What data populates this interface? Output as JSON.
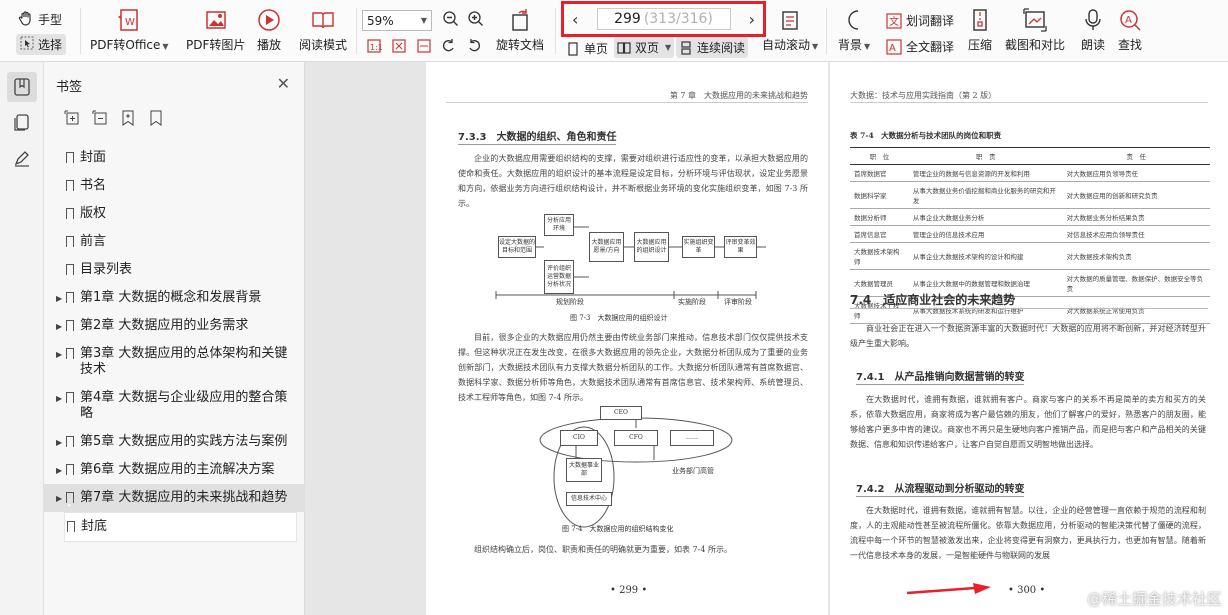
{
  "toolbar": {
    "hand_tool": "手型",
    "select_tool": "选择",
    "pdf_to_office": "PDF转Office",
    "pdf_to_image": "PDF转图片",
    "play": "播放",
    "reading_mode": "阅读模式",
    "zoom_value": "59%",
    "rotate_doc": "旋转文档",
    "current_page": "299",
    "total_pages": "(313/316)",
    "single_page": "单页",
    "double_page": "双页",
    "continuous": "连续阅读",
    "auto_scroll": "自动滚动",
    "background": "背景",
    "word_translate": "划词翻译",
    "full_translate": "全文翻译",
    "compress": "压缩",
    "screenshot_compare": "截图和对比",
    "read_aloud": "朗读",
    "find": "查找"
  },
  "panel": {
    "title": "书签",
    "bookmarks": [
      {
        "label": "封面",
        "expandable": false
      },
      {
        "label": "书名",
        "expandable": false
      },
      {
        "label": "版权",
        "expandable": false
      },
      {
        "label": "前言",
        "expandable": false
      },
      {
        "label": "目录列表",
        "expandable": false
      },
      {
        "label": "第1章 大数据的概念和发展背景",
        "expandable": true
      },
      {
        "label": "第2章 大数据应用的业务需求",
        "expandable": true
      },
      {
        "label": "第3章 大数据应用的总体架构和关键技术",
        "expandable": true
      },
      {
        "label": "第4章 大数据与企业级应用的整合策略",
        "expandable": true
      },
      {
        "label": "第5章 大数据应用的实践方法与案例",
        "expandable": true
      },
      {
        "label": "第6章 大数据应用的主流解决方案",
        "expandable": true
      },
      {
        "label": "第7章 大数据应用的未来挑战和趋势",
        "expandable": true
      },
      {
        "label": "封底",
        "expandable": false
      }
    ]
  },
  "left_page": {
    "header": "第 7 章　大数据应用的未来挑战和趋势",
    "section": "7.3.3　大数据的组织、角色和责任",
    "para1": "企业的大数据应用需要组织结构的支撑，需要对组织进行适应性的变革，以承担大数据应用的使命和责任。大数据应用的组织设计的基本流程是设定目标，分析环境与评估现状，设定业务愿景和方向，依据业务方向进行组织结构设计，并不断根据业务环境的变化实施组织变革，如图 7-3 所示。",
    "fig73": {
      "b1": "设定大数据的目标和范围",
      "b2": "分析应用环境",
      "b3": "评价组织运营数据分析状况",
      "b4": "大数据应用愿景/方向",
      "b5": "大数据应用的组织设计",
      "b6": "实施组织变革",
      "b7": "评审变革效果",
      "s1": "规划阶段",
      "s2": "实施阶段",
      "s3": "评审阶段"
    },
    "fig73_caption": "图 7-3　大数据应用的组织设计",
    "para2": "目前，很多企业的大数据应用仍然主要由传统业务部门来推动，信息技术部门仅仅提供技术支撑。但这种状况正在发生改变，在很多大数据应用的领先企业，大数据分析团队成为了重要的业务创新部门，大数据技术团队有力支撑大数据分析团队的工作。大数据分析团队通常有首席数据官、数据科学家、数据分析师等角色，大数据技术团队通常有首席信息官、技术架构师、系统管理员、技术工程师等角色，如图 7-4 所示。",
    "fig74": {
      "ceo": "CEO",
      "cio": "CIO",
      "cfo": "CFO",
      "more": "……",
      "bigdata": "大数据事业部",
      "it": "信息技术中心",
      "biz": "业务部门高管"
    },
    "fig74_caption": "图 7-4　大数据应用的组织结构变化",
    "para3": "组织结构确立后，岗位、职责和责任的明确就更为重要，如表 7-4 所示。",
    "page_number": "• 299 •"
  },
  "right_page": {
    "header": "大数据：技术与应用实践指南（第 2 版）",
    "table_caption": "表 7-4　大数据分析与技术团队的岗位和职责",
    "table_headers": [
      "职　位",
      "职　责",
      "责　任"
    ],
    "table_rows": [
      [
        "首席数据官",
        "管理企业的数据与信息资源的开发和利用",
        "对大数据应用负领导责任"
      ],
      [
        "数据科学家",
        "从事大数据业务价值挖掘和商业化服务的研究和开发",
        "对大数据应用的创新和研究负责"
      ],
      [
        "数据分析师",
        "从事企业大数据业务分析",
        "对大数据业务分析结果负责"
      ],
      [
        "首席信息官",
        "管理企业的信息技术应用",
        "对信息技术应用负领导责任"
      ],
      [
        "大数据技术架构师",
        "从事企业大数据技术架构的设计和构建",
        "对大数据技术架构负责"
      ],
      [
        "大数据管理员",
        "从事企业大数据中的数据管理和数据治理",
        "对大数据的质量管理、数据保护、数据安全等负责"
      ],
      [
        "大数据技术工程师",
        "从事大数据技术系统的研发和运行维护",
        "对大数据系统正常使用负责"
      ]
    ],
    "section74": "7.4　适应商业社会的未来趋势",
    "para74": "商业社会正在进入一个数据资源丰富的大数据时代！大数据的应用将不断创新，并对经济转型升级产生重大影响。",
    "section741": "7.4.1　从产品推销向数据营销的转变",
    "para741": "在大数据时代，谁拥有数据，谁就拥有客户。商家与客户的关系不再是简单的卖方和买方的关系，依靠大数据应用，商家将成为客户最信赖的朋友，他们了解客户的爱好，熟悉客户的朋友圈，能够给客户更多中肯的建议。商家也不再只是生硬地向客户推销产品，而是把与客户和产品相关的关键数据、信息和知识传递给客户，让客户自觉自愿而又明智地做出选择。",
    "section742": "7.4.2　从流程驱动到分析驱动的转变",
    "para742": "在大数据时代，谁拥有数据，谁就拥有智慧。以往，企业的经营管理一直依赖于规范的流程和制度，人的主观能动性甚至被流程所僵化。依靠大数据应用，分析驱动的智能决策代替了僵硬的流程，流程中每一个环节的智慧被激发出来，企业将变得更有洞察力，更具执行力，也更加有智慧。随着新一代信息技术本身的发展，一是智能硬件与物联网的发展",
    "page_number": "• 300 •"
  },
  "watermark": "@稀土掘金技术社区",
  "colors": {
    "highlight_border": "#e8202a",
    "arrow": "#e8202a"
  }
}
